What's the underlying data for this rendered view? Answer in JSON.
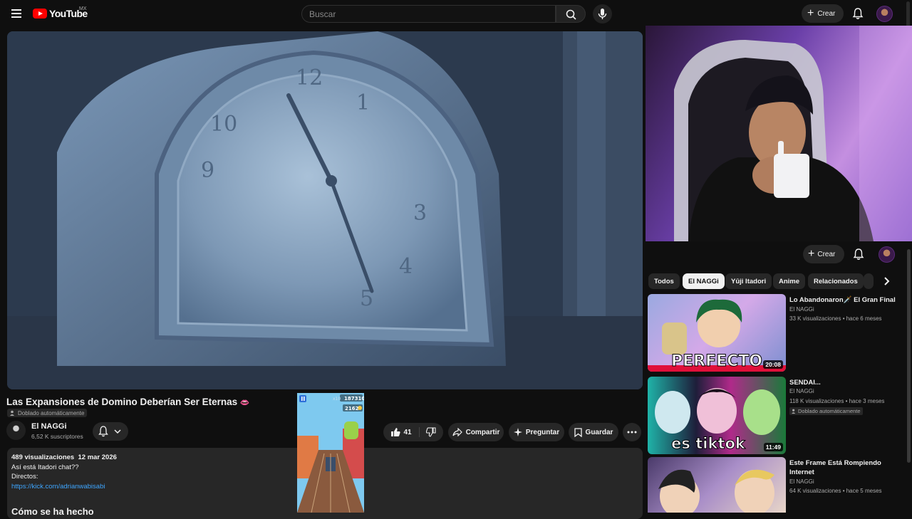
{
  "header": {
    "logo_text": "YouTube",
    "country_code": "MX",
    "search_placeholder": "Buscar",
    "create_label": "Crear"
  },
  "video": {
    "title": "Las Expansiones de Domino Deberían Ser Eternas",
    "title_emoji": "👄",
    "dubbed_label": "Doblado automáticamente",
    "channel_name": "El NAGGi",
    "subscribers": "6,52 K suscriptores",
    "likes": "41",
    "share_label": "Compartir",
    "ask_label": "Preguntar",
    "save_label": "Guardar",
    "clock_numbers": [
      "12",
      "1",
      "10",
      "9",
      "3",
      "4",
      "5"
    ]
  },
  "description": {
    "views": "489 visualizaciones",
    "date": "12 mar 2026",
    "line1": "Así está Itadori chat??",
    "line2": "Directos:",
    "link": "https://kick.com/adrianwabisabi",
    "heading": "Cómo se ha hecho"
  },
  "mini_overlay": {
    "score": "187310",
    "coins": "2162",
    "multiplier": "x10"
  },
  "sidebar": {
    "create_label": "Crear",
    "chips": [
      {
        "label": "Todos",
        "active": false
      },
      {
        "label": "El NAGGi",
        "active": true
      },
      {
        "label": "Yūji Itadori",
        "active": false
      },
      {
        "label": "Anime",
        "active": false
      },
      {
        "label": "Relacionados",
        "active": false
      }
    ],
    "videos": [
      {
        "title": "Lo Abandonaron🗡️ El Gran Final",
        "channel": "El NAGGi",
        "views": "33 K visualizaciones • hace 6 meses",
        "duration": "20:08",
        "thumb_text": "PERFECTO",
        "badge": ""
      },
      {
        "title": "SENDAI...",
        "channel": "El NAGGi",
        "views": "118 K visualizaciones • hace 3 meses",
        "duration": "11:49",
        "thumb_text": "es tiktok",
        "badge": "Doblado automáticamente"
      },
      {
        "title": "Este Frame Está Rompiendo Internet",
        "channel": "El NAGGi",
        "views": "64 K visualizaciones • hace 5 meses",
        "duration": "",
        "thumb_text": "",
        "badge": ""
      }
    ]
  }
}
